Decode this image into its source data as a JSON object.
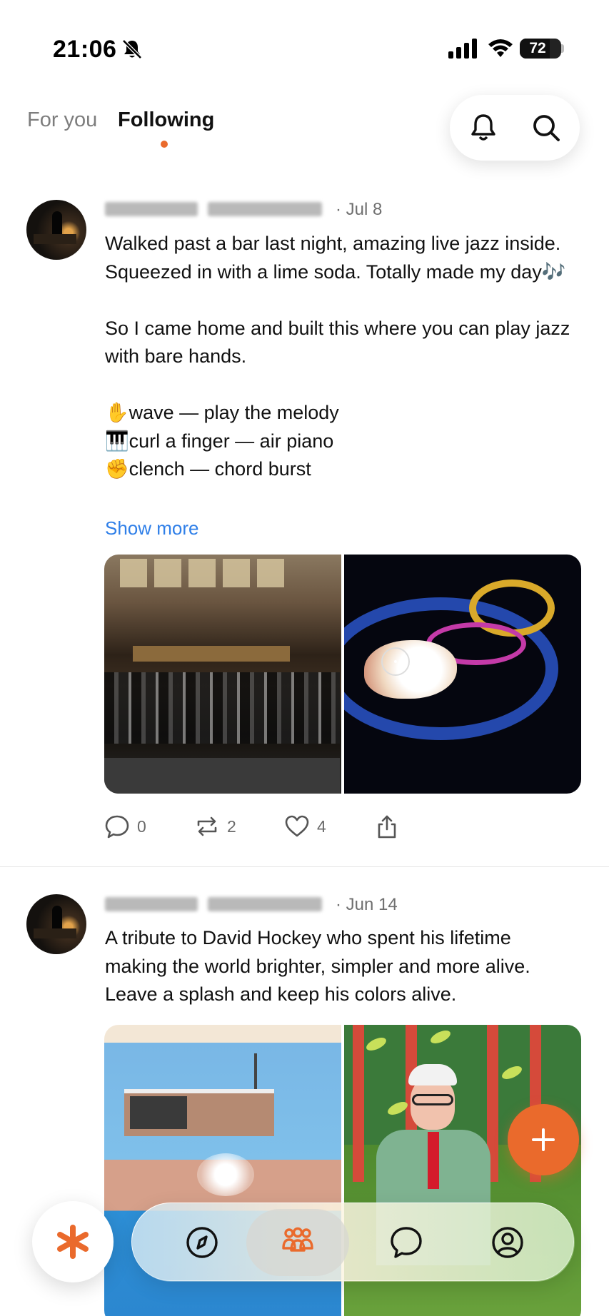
{
  "status_bar": {
    "time": "21:06",
    "battery": "72",
    "icons": [
      "bell-slash-icon",
      "cellular-signal-icon",
      "wifi-icon",
      "battery-icon"
    ]
  },
  "header": {
    "tabs": [
      {
        "label": "For you",
        "active": false
      },
      {
        "label": "Following",
        "active": true
      }
    ],
    "accent_color": "#ea6a2c",
    "actions": [
      "bell-icon",
      "search-icon"
    ]
  },
  "posts": [
    {
      "date": "Jul 8",
      "text": "Walked past a bar last night, amazing live jazz inside. Squeezed in with a lime soda. Totally made my day🎶\n\nSo I came home and built this where you can play jazz with bare hands.\n\n✋wave — play the melody\n🎹curl a finger — air piano\n✊clench — chord burst",
      "show_more": "Show more",
      "stats": {
        "comments": "0",
        "reposts": "2",
        "likes": "4"
      }
    },
    {
      "date": "Jun 14",
      "text": "A tribute to David Hockey who spent his lifetime making the world brighter, simpler and more alive. Leave a splash and keep his colors alive."
    }
  ],
  "bottom_nav": {
    "home": "asterisk-icon",
    "items": [
      "compass-icon",
      "people-icon",
      "chat-icon",
      "profile-icon"
    ],
    "active_index": 1,
    "active_color": "#ea6a2c"
  }
}
